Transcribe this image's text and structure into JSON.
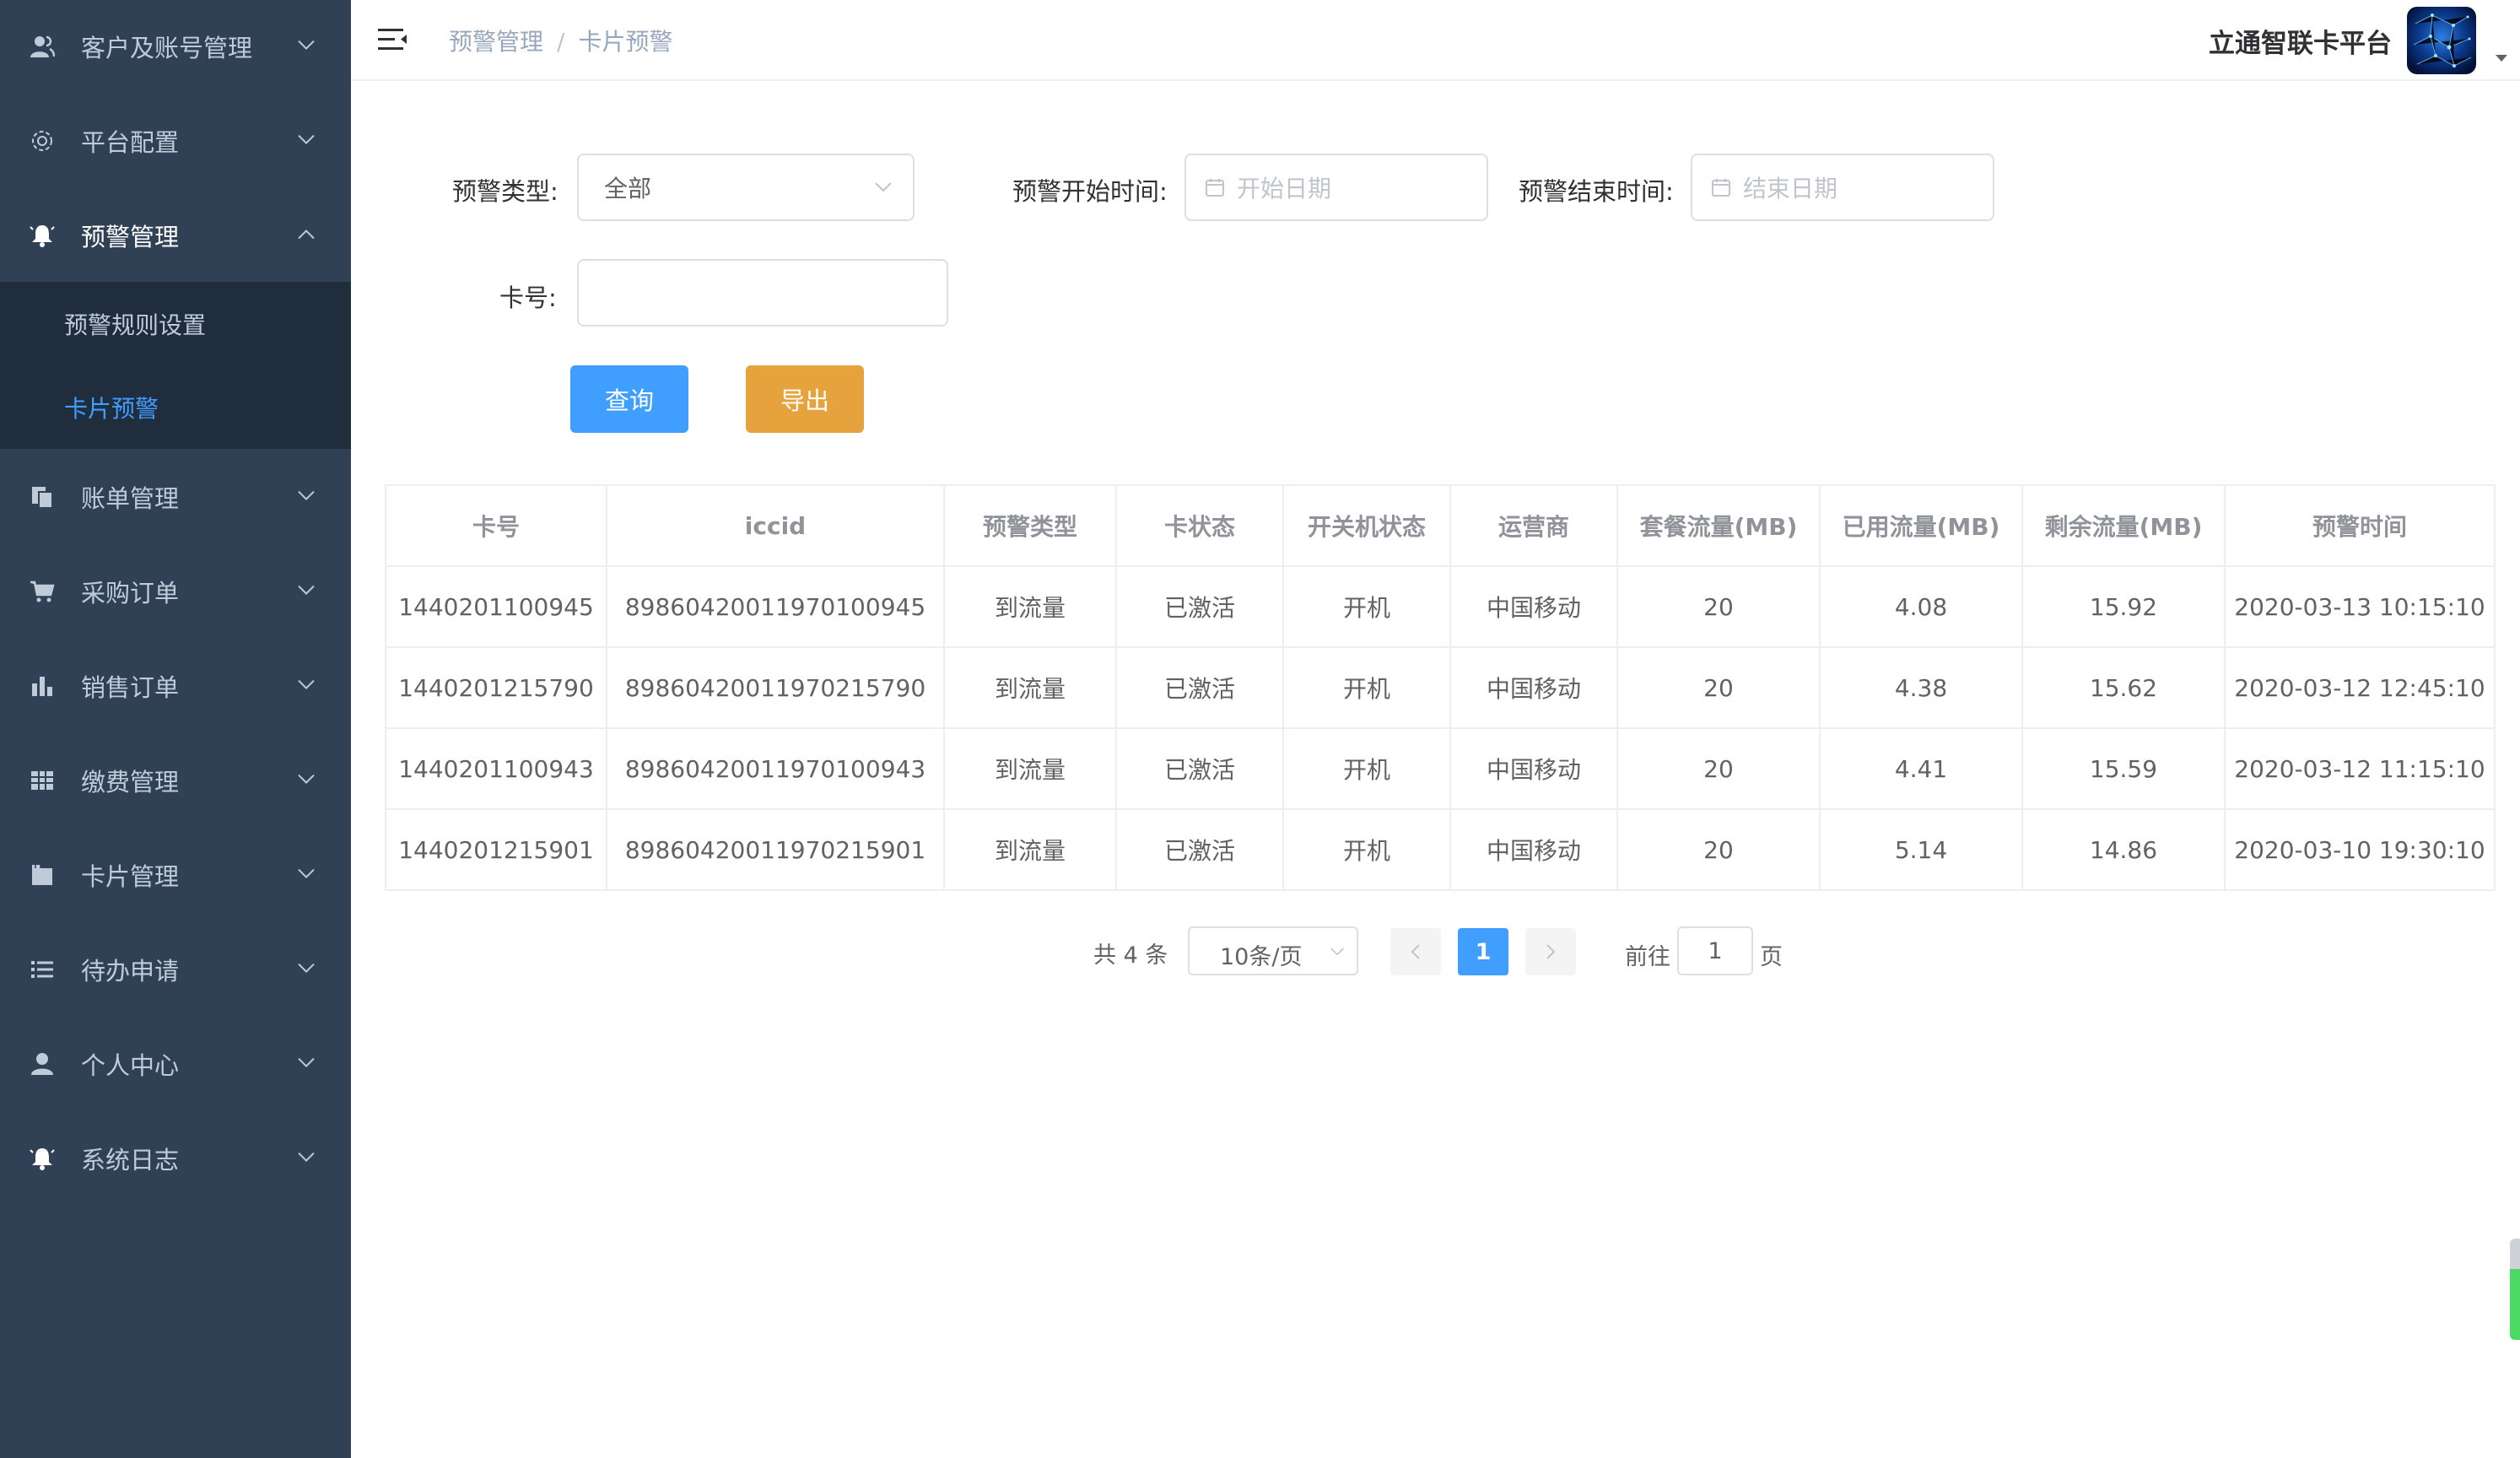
{
  "sidebar": {
    "items": [
      {
        "label": "客户及账号管理",
        "icon": "user-group-icon"
      },
      {
        "label": "平台配置",
        "icon": "gear-icon"
      },
      {
        "label": "预警管理",
        "icon": "bell-icon",
        "open": true
      },
      {
        "label": "账单管理",
        "icon": "document-copy-icon"
      },
      {
        "label": "采购订单",
        "icon": "cart-icon"
      },
      {
        "label": "销售订单",
        "icon": "bar-chart-icon"
      },
      {
        "label": "缴费管理",
        "icon": "grid-icon"
      },
      {
        "label": "卡片管理",
        "icon": "folder-icon"
      },
      {
        "label": "待办申请",
        "icon": "list-icon"
      },
      {
        "label": "个人中心",
        "icon": "person-icon"
      },
      {
        "label": "系统日志",
        "icon": "bell-icon"
      }
    ],
    "submenu": [
      {
        "label": "预警规则设置",
        "active": false
      },
      {
        "label": "卡片预警",
        "active": true
      }
    ]
  },
  "header": {
    "breadcrumb": [
      "预警管理",
      "卡片预警"
    ],
    "breadcrumb_separator": "/",
    "platform_title": "立通智联卡平台"
  },
  "filters": {
    "type_label": "预警类型:",
    "type_value": "全部",
    "start_label": "预警开始时间:",
    "start_placeholder": "开始日期",
    "end_label": "预警结束时间:",
    "end_placeholder": "结束日期",
    "card_label": "卡号:",
    "card_value": "",
    "query_button": "查询",
    "export_button": "导出"
  },
  "table": {
    "columns": [
      "卡号",
      "iccid",
      "预警类型",
      "卡状态",
      "开关机状态",
      "运营商",
      "套餐流量(MB)",
      "已用流量(MB)",
      "剩余流量(MB)",
      "预警时间"
    ],
    "rows": [
      [
        "1440201100945",
        "89860420011970100945",
        "到流量",
        "已激活",
        "开机",
        "中国移动",
        "20",
        "4.08",
        "15.92",
        "2020-03-13 10:15:10"
      ],
      [
        "1440201215790",
        "89860420011970215790",
        "到流量",
        "已激活",
        "开机",
        "中国移动",
        "20",
        "4.38",
        "15.62",
        "2020-03-12 12:45:10"
      ],
      [
        "1440201100943",
        "89860420011970100943",
        "到流量",
        "已激活",
        "开机",
        "中国移动",
        "20",
        "4.41",
        "15.59",
        "2020-03-12 11:15:10"
      ],
      [
        "1440201215901",
        "89860420011970215901",
        "到流量",
        "已激活",
        "开机",
        "中国移动",
        "20",
        "5.14",
        "14.86",
        "2020-03-10 19:30:10"
      ]
    ]
  },
  "pagination": {
    "total_text": "共 4 条",
    "page_size": "10条/页",
    "current_page": "1",
    "goto_label": "前往",
    "goto_value": "1",
    "page_suffix": "页"
  },
  "colors": {
    "sidebar_bg": "#304156",
    "submenu_bg": "#1f2d3d",
    "primary": "#409eff",
    "warning": "#e6a23c",
    "menu_text": "#bfcbd9"
  }
}
